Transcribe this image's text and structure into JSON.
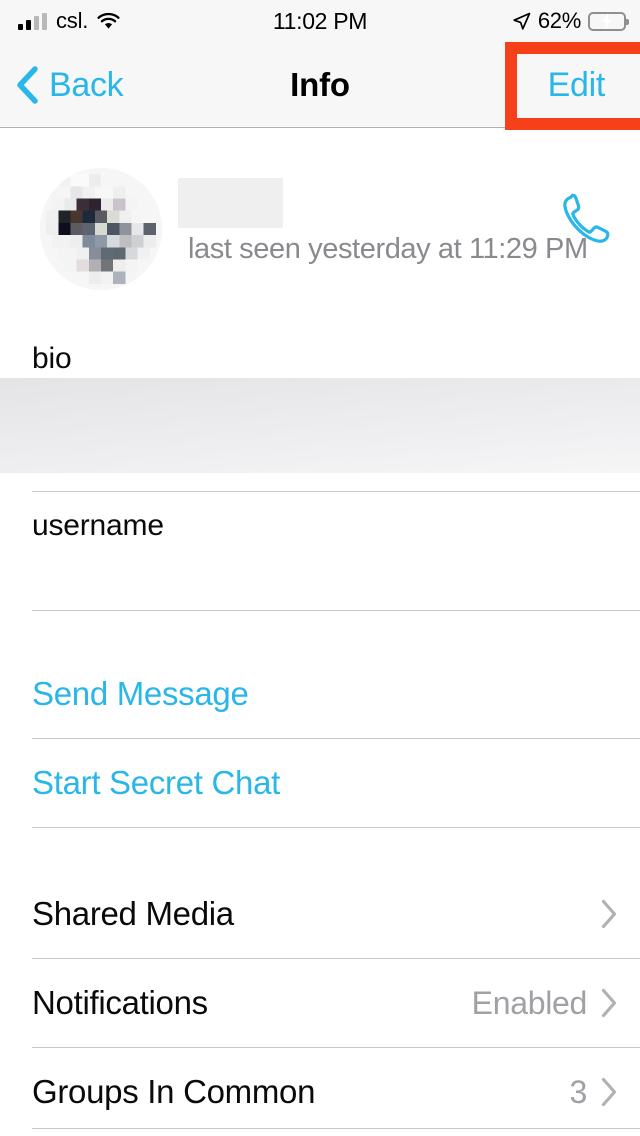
{
  "status_bar": {
    "carrier": "csl.",
    "time": "11:02 PM",
    "battery_percent": "62%",
    "battery_level": 62,
    "charging": true,
    "signal_bars_filled": 2,
    "signal_bars_total": 4,
    "wifi": true,
    "location_arrow": true
  },
  "nav": {
    "back_label": "Back",
    "title": "Info",
    "edit_label": "Edit",
    "highlight_color": "#f5401a",
    "accent_color": "#29b6e8"
  },
  "profile": {
    "name": "",
    "name_redacted": true,
    "status": "last seen yesterday at 11:29 PM",
    "avatar_redacted": true,
    "call_action": "call"
  },
  "bio_section": {
    "label": "bio",
    "value": "",
    "value_redacted": true
  },
  "username_section": {
    "label": "username",
    "value": "",
    "value_redacted": true
  },
  "actions": [
    {
      "label": "Send Message"
    },
    {
      "label": "Start Secret Chat"
    }
  ],
  "list_rows": [
    {
      "title": "Shared Media",
      "value": "",
      "chevron": true
    },
    {
      "title": "Notifications",
      "value": "Enabled",
      "chevron": true
    },
    {
      "title": "Groups In Common",
      "value": "3",
      "chevron": true
    }
  ]
}
